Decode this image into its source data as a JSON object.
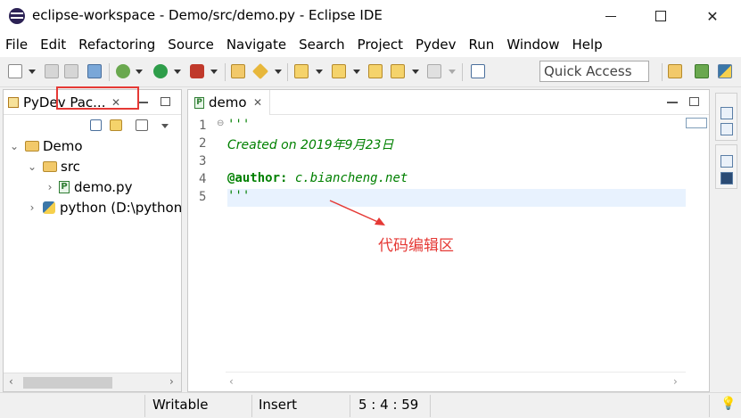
{
  "window": {
    "title": "eclipse-workspace - Demo/src/demo.py - Eclipse IDE"
  },
  "menu": [
    "File",
    "Edit",
    "Refactoring",
    "Source",
    "Navigate",
    "Search",
    "Project",
    "Pydev",
    "Run",
    "Window",
    "Help"
  ],
  "toolbar": {
    "quick_access_placeholder": "Quick Access"
  },
  "left_panel": {
    "tab_label": "PyDev Pac...",
    "tree": [
      {
        "label": "Demo",
        "icon": "project-folder-icon",
        "expanded": true
      },
      {
        "label": "src",
        "icon": "source-folder-icon",
        "expanded": true
      },
      {
        "label": "demo.py",
        "icon": "python-file-icon",
        "selected": true
      },
      {
        "label": "python  (D:\\python",
        "icon": "python-interpreter-icon"
      }
    ]
  },
  "editor": {
    "tab_label": "demo",
    "lines": [
      {
        "no": "1",
        "parts": [
          {
            "text": "'''",
            "style": "g"
          }
        ]
      },
      {
        "no": "2",
        "parts": [
          {
            "text": "Created on 2019年9月23日",
            "style": "g"
          }
        ]
      },
      {
        "no": "3",
        "parts": [
          {
            "text": "",
            "style": "g"
          }
        ]
      },
      {
        "no": "4",
        "parts": [
          {
            "text": "@author:",
            "style": "b"
          },
          {
            "text": " c.biancheng.net",
            "style": "g"
          }
        ]
      },
      {
        "no": "5",
        "parts": [
          {
            "text": "'''",
            "style": "g"
          }
        ]
      }
    ]
  },
  "annotation": {
    "label": "代码编辑区",
    "color": "#e53935"
  },
  "statusbar": {
    "mode": "Writable",
    "insert": "Insert",
    "position": "5 : 4 : 59"
  }
}
